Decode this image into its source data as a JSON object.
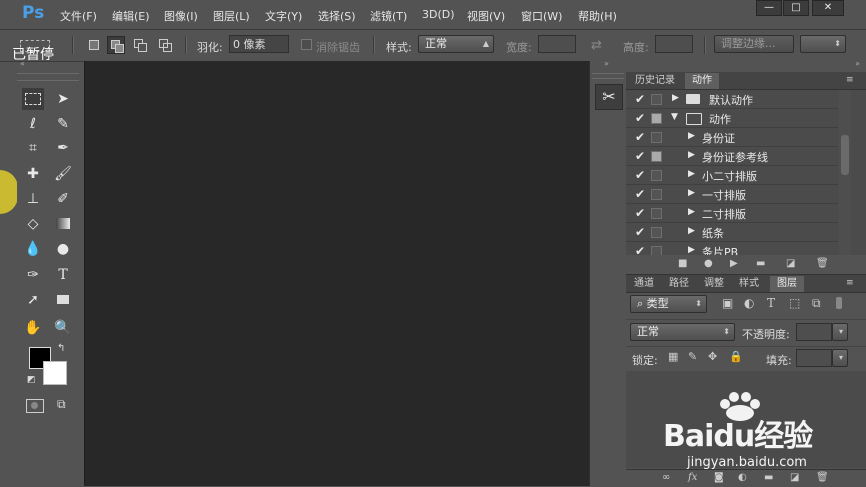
{
  "app": {
    "logo": "Ps"
  },
  "menu": [
    "文件(F)",
    "编辑(E)",
    "图像(I)",
    "图层(L)",
    "文字(Y)",
    "选择(S)",
    "滤镜(T)",
    "3D(D)",
    "视图(V)",
    "窗口(W)",
    "帮助(H)"
  ],
  "window_controls": {
    "minimize": "—",
    "restore": "□",
    "close": "✕"
  },
  "overlay": {
    "paused_text": "已暂停"
  },
  "options": {
    "feather_label": "羽化:",
    "feather_value": "0 像素",
    "antialias_label": "消除锯齿",
    "style_label": "样式:",
    "style_value": "正常",
    "width_label": "宽度:",
    "height_label": "高度:",
    "refine_edge_label": "调整边缘..."
  },
  "actions_panel": {
    "tabs": [
      "历史记录",
      "动作"
    ],
    "active_tab": "动作",
    "rows": [
      {
        "label": "默认动作",
        "type": "set",
        "expanded": false,
        "dialog": false
      },
      {
        "label": "动作",
        "type": "set",
        "expanded": true,
        "dialog": true
      },
      {
        "label": "身份证",
        "type": "action",
        "dialog": false
      },
      {
        "label": "身份证参考线",
        "type": "action",
        "dialog": true
      },
      {
        "label": "小二寸排版",
        "type": "action",
        "dialog": false
      },
      {
        "label": "一寸排版",
        "type": "action",
        "dialog": false
      },
      {
        "label": "二寸排版",
        "type": "action",
        "dialog": false
      },
      {
        "label": "纸条",
        "type": "action",
        "dialog": false
      },
      {
        "label": "条片PB",
        "type": "action",
        "dialog": false
      }
    ]
  },
  "layers_panel": {
    "tabs": [
      "通道",
      "路径",
      "调整",
      "样式",
      "图层"
    ],
    "active_tab": "图层",
    "filter_label": "类型",
    "blend_mode": "正常",
    "opacity_label": "不透明度:",
    "lock_label": "锁定:",
    "fill_label": "填充:"
  },
  "watermark": {
    "brand": "Baidu经验",
    "url": "jingyan.baidu.com"
  },
  "colors": {
    "foreground": "#000000",
    "background": "#ffffff",
    "logo": "#4a9fe8",
    "canvas": "#282828",
    "ui": "#535353"
  }
}
